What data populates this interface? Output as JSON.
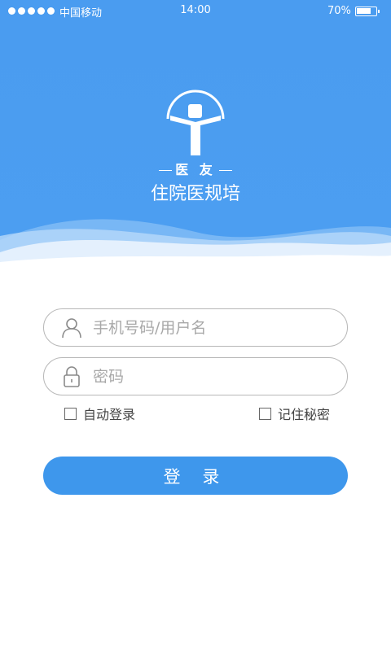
{
  "status_bar": {
    "carrier": "中国移动",
    "time": "14:00",
    "battery": "70%",
    "battery_level": 0.7,
    "signal_dots": 5
  },
  "brand": {
    "name": "医 友",
    "subtitle": "住院医规培"
  },
  "form": {
    "username_placeholder": "手机号码/用户名",
    "password_placeholder": "密码",
    "auto_login_label": "自动登录",
    "remember_label": "记住秘密",
    "login_label": "登 录"
  },
  "icons": {
    "user": "user-icon",
    "lock": "lock-icon"
  },
  "colors": {
    "primary": "#4a9cf0",
    "button": "#3e97ec"
  }
}
